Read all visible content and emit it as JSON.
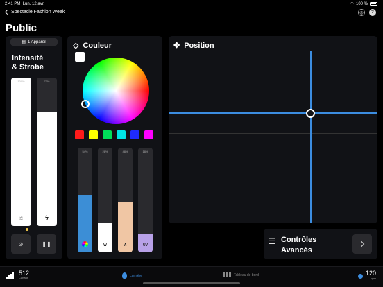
{
  "status_bar": {
    "time": "2:41 PM",
    "date": "Lun. 12 avr.",
    "battery": "100 %"
  },
  "nav": {
    "back_label": "Spectacle Fashion Week"
  },
  "page": {
    "title": "Public"
  },
  "intensity": {
    "device_label": "1 Appareil",
    "title_line1": "Intensité",
    "title_line2": "& Strobe",
    "sliders": [
      {
        "name": "intensity",
        "label": "100%",
        "value": 1.0,
        "icon": "sun-icon",
        "fill": "#ffffff"
      },
      {
        "name": "strobe",
        "label": "77%",
        "value": 0.77,
        "icon": "lightning-icon",
        "fill": "#ffffff"
      }
    ]
  },
  "color": {
    "title": "Couleur",
    "swatches": [
      "#ff1a1a",
      "#ffff00",
      "#00e05a",
      "#00e5e5",
      "#1f2bff",
      "#ff00ff"
    ],
    "sliders": [
      {
        "name": "color",
        "label": "54%",
        "value": 0.54,
        "glyph": "",
        "fill": "#3c8ed6"
      },
      {
        "name": "white",
        "label": "28%",
        "value": 0.28,
        "glyph": "W",
        "fill": "#ffffff"
      },
      {
        "name": "amber",
        "label": "48%",
        "value": 0.48,
        "glyph": "A",
        "fill": "#f0c6a4"
      },
      {
        "name": "uv",
        "label": "18%",
        "value": 0.18,
        "glyph": "UV",
        "fill": "#b8a1e8"
      }
    ]
  },
  "position": {
    "title": "Position",
    "pan": 0.68,
    "tilt": 0.36
  },
  "advanced": {
    "line1": "Contrôles",
    "line2": "Avancés"
  },
  "tabbar": {
    "channels_value": "512",
    "channels_label": "Canaux",
    "tab_light": "Lumière",
    "tab_dashboard": "Tableau de bord",
    "bpm_value": "120",
    "bpm_label": "bpm"
  },
  "colors": {
    "accent": "#3c8de0",
    "panel": "#111216",
    "control": "#2a2a2e"
  }
}
